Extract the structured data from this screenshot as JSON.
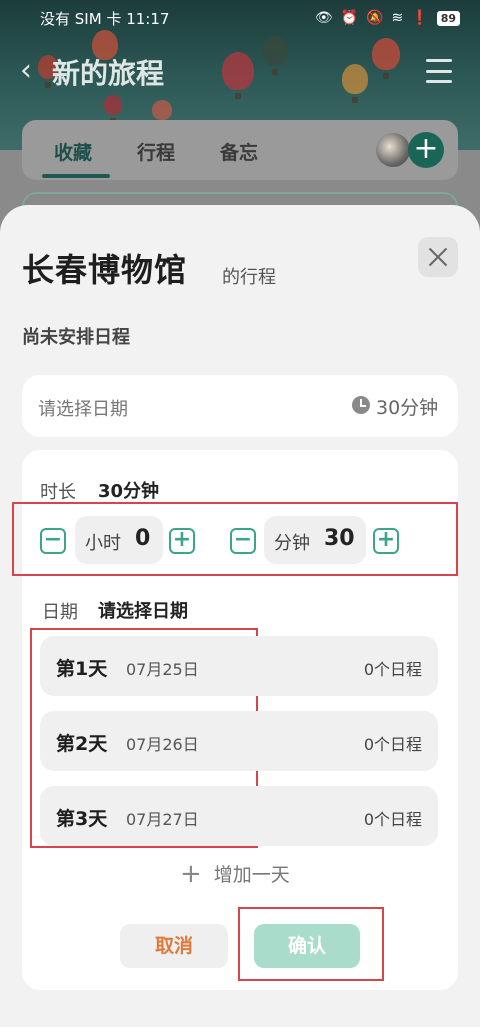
{
  "status_bar": {
    "carrier": "没有 SIM 卡",
    "time": "11:17",
    "battery": "89"
  },
  "app_header": {
    "title": "新的旅程"
  },
  "tabs": [
    {
      "label": "收藏"
    },
    {
      "label": "行程"
    },
    {
      "label": "备忘"
    }
  ],
  "sheet": {
    "title": "长春博物馆",
    "subtitle": "的行程",
    "no_schedule": "尚未安排日程",
    "date_placeholder": "请选择日期",
    "duration_display": "30分钟",
    "duration_label": "时长",
    "duration_value": "30分钟",
    "hours_unit": "小时",
    "hours_value": "0",
    "minutes_unit": "分钟",
    "minutes_value": "30",
    "date_label": "日期",
    "date_value": "请选择日期",
    "days": [
      {
        "name": "第1天",
        "date": "07月25日",
        "count": "0个日程"
      },
      {
        "name": "第2天",
        "date": "07月26日",
        "count": "0个日程"
      },
      {
        "name": "第3天",
        "date": "07月27日",
        "count": "0个日程"
      }
    ],
    "add_day": "增加一天",
    "cancel": "取消",
    "confirm": "确认"
  },
  "colors": {
    "accent": "#3aa48c",
    "confirm_disabled": "#a9dccb",
    "cancel_text": "#e07a3a",
    "annotation_red": "#d9434b"
  }
}
